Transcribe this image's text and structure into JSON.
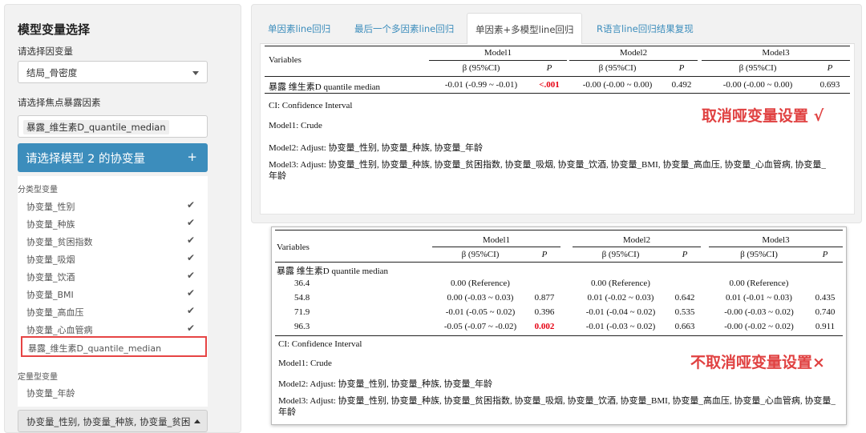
{
  "sidebar": {
    "title": "模型变量选择",
    "outcome_label": "请选择因变量",
    "outcome_value": "结局_骨密度",
    "exposure_label": "请选择焦点暴露因素",
    "exposure_chip": "暴露_维生素D_quantile_median",
    "covariate_header": "请选择模型 2 的协变量",
    "covariate_plus": "+",
    "group_categorical": "分类型变量",
    "categorical_options": [
      "协变量_性别",
      "协变量_种族",
      "协变量_贫困指数",
      "协变量_吸烟",
      "协变量_饮酒",
      "协变量_BMI",
      "协变量_高血压",
      "协变量_心血管病"
    ],
    "check_icon": "✔",
    "highlighted_option": "暴露_维生素D_quantile_median",
    "group_continuous": "定量型变量",
    "continuous_options": [
      "协变量_年龄"
    ],
    "selected_summary": "协变量_性别, 协变量_种族, 协变量_贫困"
  },
  "tabs": [
    {
      "label": "单因素line回归"
    },
    {
      "label": "最后一个多因素line回归"
    },
    {
      "label": "单因素+多模型line回归"
    },
    {
      "label": "R语言line回归结果复现"
    }
  ],
  "common": {
    "col_variables": "Variables",
    "model1": "Model1",
    "model2": "Model2",
    "model3": "Model3",
    "beta_ci": "β (95%CI)",
    "p": "P"
  },
  "table1": {
    "row_label": "暴露 维生素D quantile median",
    "cells": [
      "-0.01 (-0.99 ~ -0.01)",
      "<.001",
      "-0.00 (-0.00 ~ 0.00)",
      "0.492",
      "-0.00 (-0.00 ~ 0.00)",
      "0.693"
    ],
    "notes": [
      "CI: Confidence Interval",
      "Model1: Crude",
      "Model2: Adjust: 协变量_性别, 协变量_种族, 协变量_年龄",
      "Model3: Adjust: 协变量_性别, 协变量_种族, 协变量_贫困指数, 协变量_吸烟, 协变量_饮酒, 协变量_BMI, 协变量_高血压, 协变量_心血管病, 协变量_年龄"
    ],
    "annotation": "取消哑变量设置 √"
  },
  "table2": {
    "row_label": "暴露 维生素D quantile median",
    "rows": [
      {
        "level": "36.4",
        "m1": "0.00 (Reference)",
        "p1": "",
        "m2": "0.00 (Reference)",
        "p2": "",
        "m3": "0.00 (Reference)",
        "p3": ""
      },
      {
        "level": "54.8",
        "m1": "0.00 (-0.03 ~ 0.03)",
        "p1": "0.877",
        "m2": "0.01 (-0.02 ~ 0.03)",
        "p2": "0.642",
        "m3": "0.01 (-0.01 ~ 0.03)",
        "p3": "0.435"
      },
      {
        "level": "71.9",
        "m1": "-0.01 (-0.05 ~ 0.02)",
        "p1": "0.396",
        "m2": "-0.01 (-0.04 ~ 0.02)",
        "p2": "0.535",
        "m3": "-0.00 (-0.03 ~ 0.02)",
        "p3": "0.740"
      },
      {
        "level": "96.3",
        "m1": "-0.05 (-0.07 ~ -0.02)",
        "p1": "0.002",
        "m2": "-0.01 (-0.03 ~ 0.02)",
        "p2": "0.663",
        "m3": "-0.00 (-0.02 ~ 0.02)",
        "p3": "0.911"
      }
    ],
    "notes": [
      "CI: Confidence Interval",
      "Model1: Crude",
      "Model2: Adjust: 协变量_性别, 协变量_种族, 协变量_年龄",
      "Model3: Adjust: 协变量_性别, 协变量_种族, 协变量_贫困指数, 协变量_吸烟, 协变量_饮酒, 协变量_BMI, 协变量_高血压, 协变量_心血管病, 协变量_年龄"
    ],
    "annotation": "不取消哑变量设置×"
  },
  "colors": {
    "accent": "#3c8dbc",
    "significant": "#e60012",
    "annotation": "#e04141"
  }
}
